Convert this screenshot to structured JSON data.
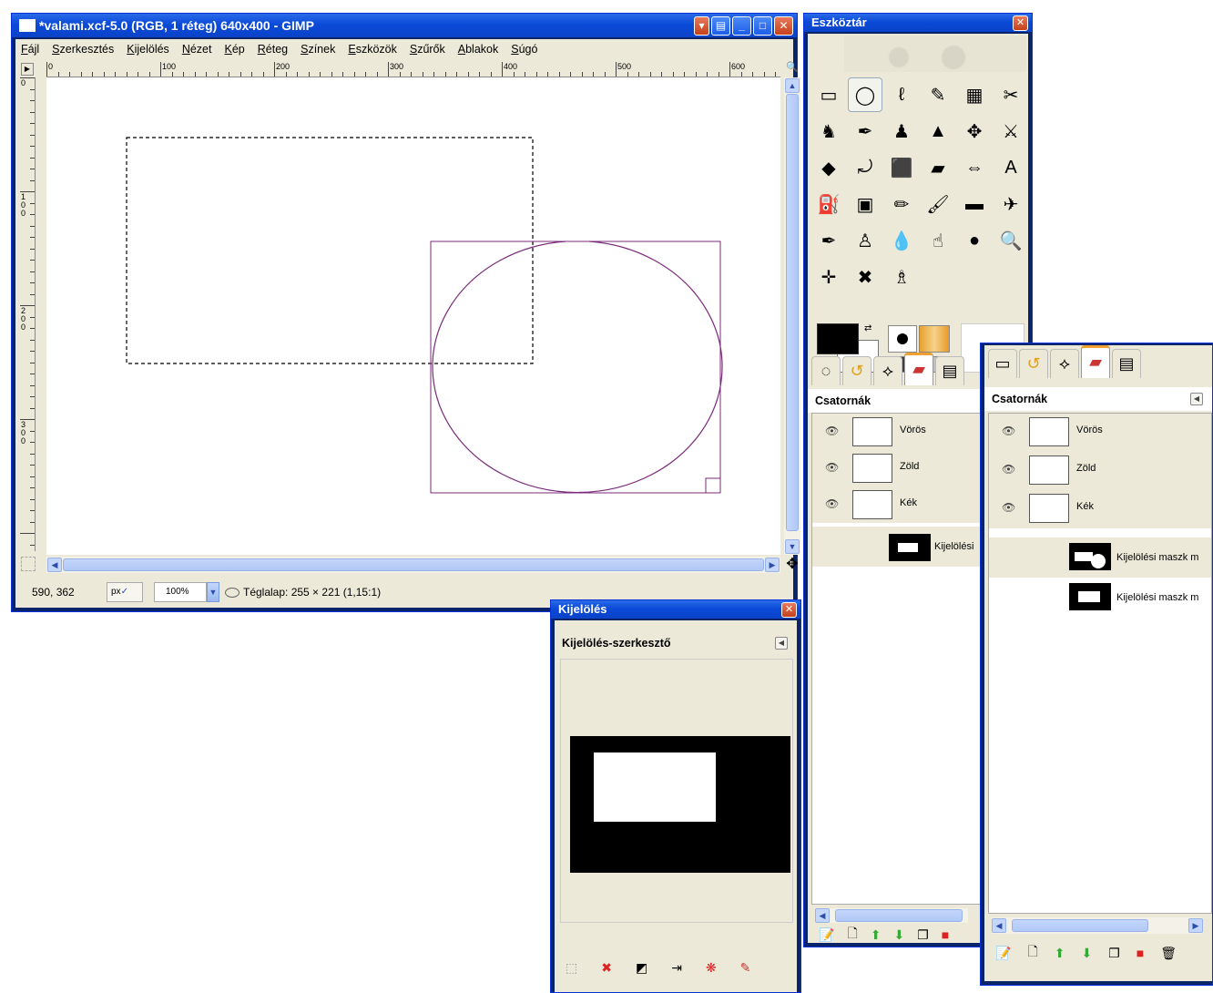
{
  "image_window": {
    "title": "*valami.xcf-5.0 (RGB, 1 réteg) 640x400 - GIMP",
    "menu": [
      "Fájl",
      "Szerkesztés",
      "Kijelölés",
      "Nézet",
      "Kép",
      "Réteg",
      "Színek",
      "Eszközök",
      "Szűrők",
      "Ablakok",
      "Súgó"
    ],
    "hruler_labels": [
      "0",
      "100",
      "200",
      "300",
      "400",
      "500",
      "600"
    ],
    "vruler_labels": [
      "0",
      "100",
      "200",
      "300"
    ],
    "status": {
      "coords": "590, 362",
      "unit": "px",
      "zoom": "100%",
      "info": "Téglalap: 255 × 221 (1,15:1)"
    }
  },
  "toolbox": {
    "title": "Eszköztár",
    "tools": [
      {
        "name": "rect-select-icon",
        "glyph": "▭"
      },
      {
        "name": "ellipse-select-icon",
        "glyph": "◯"
      },
      {
        "name": "free-select-icon",
        "glyph": "ℓ"
      },
      {
        "name": "fuzzy-select-icon",
        "glyph": "✎"
      },
      {
        "name": "by-color-select-icon",
        "glyph": "▦"
      },
      {
        "name": "scissors-icon",
        "glyph": "✂"
      },
      {
        "name": "foreground-select-icon",
        "glyph": "♞"
      },
      {
        "name": "paths-icon",
        "glyph": "✒"
      },
      {
        "name": "color-picker-icon",
        "glyph": "♟"
      },
      {
        "name": "measure-icon",
        "glyph": "▲"
      },
      {
        "name": "move-icon",
        "glyph": "✥"
      },
      {
        "name": "alignment-icon",
        "glyph": "⚔"
      },
      {
        "name": "crop-icon",
        "glyph": "◆"
      },
      {
        "name": "rotate-icon",
        "glyph": "⤾"
      },
      {
        "name": "scale-icon",
        "glyph": "⬛"
      },
      {
        "name": "shear-icon",
        "glyph": "▰"
      },
      {
        "name": "flip-icon",
        "glyph": "⇔"
      },
      {
        "name": "text-icon",
        "glyph": "A"
      },
      {
        "name": "bucket-fill-icon",
        "glyph": "⛽"
      },
      {
        "name": "blend-icon",
        "glyph": "▣"
      },
      {
        "name": "pencil-icon",
        "glyph": "✏"
      },
      {
        "name": "paintbrush-icon",
        "glyph": "🖌"
      },
      {
        "name": "eraser-icon",
        "glyph": "▬"
      },
      {
        "name": "airbrush-icon",
        "glyph": "✈"
      },
      {
        "name": "ink-icon",
        "glyph": "✒"
      },
      {
        "name": "clone-icon",
        "glyph": "♙"
      },
      {
        "name": "blur-icon",
        "glyph": "💧"
      },
      {
        "name": "smudge-icon",
        "glyph": "☝"
      },
      {
        "name": "dodge-burn-icon",
        "glyph": "●"
      },
      {
        "name": "zoom-icon",
        "glyph": "🔍"
      },
      {
        "name": "transform-icon",
        "glyph": "✛"
      },
      {
        "name": "heal-icon",
        "glyph": "✖"
      },
      {
        "name": "perspective-clone-icon",
        "glyph": "♗"
      }
    ]
  },
  "channels_panel_1": {
    "header": "Csatornák",
    "channels": [
      "Vörös",
      "Zöld",
      "Kék"
    ],
    "masks": [
      "Kijelölési"
    ]
  },
  "channels_panel_2": {
    "header": "Csatornák",
    "channels": [
      "Vörös",
      "Zöld",
      "Kék"
    ],
    "masks": [
      "Kijelölési maszk m",
      "Kijelölési maszk m"
    ]
  },
  "selection_window": {
    "title": "Kijelölés",
    "header": "Kijelölés-szerkesztő"
  }
}
